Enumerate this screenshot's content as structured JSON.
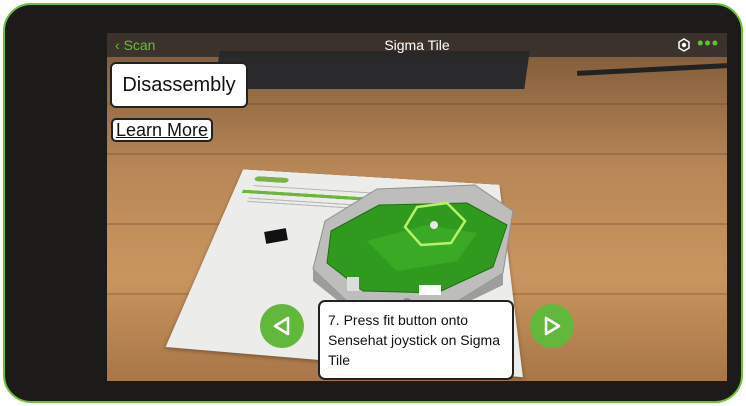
{
  "topbar": {
    "back_label": "Scan",
    "title": "Sigma Tile",
    "right_icons": [
      "target-icon",
      "more-icon"
    ],
    "accent_color": "#5fc235"
  },
  "overlay": {
    "section_label": "Disassembly",
    "learn_more_label": "Learn More",
    "step_text": "7. Press fit button onto Sensehat joystick on Sigma Tile",
    "prev_icon": "play-left-icon",
    "next_icon": "play-right-icon"
  },
  "colors": {
    "frame_border": "#6bc232",
    "nav_button": "#62b83a",
    "model_green": "#2f9a1e"
  }
}
